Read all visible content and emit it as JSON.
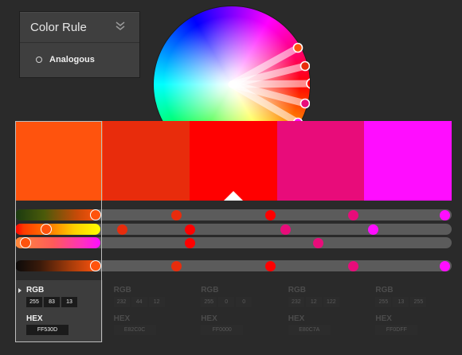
{
  "color_rule": {
    "title": "Color Rule",
    "selected_option": "Analogous",
    "collapse_icon": "double-chevron-down-icon"
  },
  "wheel": {
    "markers": [
      "#ff530d",
      "#e82c0c",
      "#ff0000",
      "#e80c7a",
      "#ff0dff"
    ],
    "selected_index": 2
  },
  "swatches": [
    {
      "hex": "#ff530d",
      "selected": true
    },
    {
      "hex": "#e82c0c",
      "selected": false
    },
    {
      "hex": "#ff0000",
      "selected": false
    },
    {
      "hex": "#e80c7a",
      "selected": false
    },
    {
      "hex": "#ff0dff",
      "selected": false
    }
  ],
  "slider_rows": [
    {
      "name": "brightness",
      "fill": "linear-gradient(90deg,#1a3a10 0%,#4a5a0a 35%,#c84a08 75%,#ff530d 100%)",
      "fill_fraction": 0.19,
      "handle_fraction": 0.185,
      "dot_fractions": [
        0.37,
        0.585,
        0.775,
        0.985
      ],
      "dot_colors": [
        "#e82c0c",
        "#ff0000",
        "#e80c7a",
        "#ff0dff"
      ]
    },
    {
      "name": "hue",
      "fill": "linear-gradient(90deg,#ff0000 0%,#ff3a00 10%,#ff7a00 40%,#ffd000 70%,#ffff00 100%)",
      "fill_fraction": 0.195,
      "handle_fraction": 0.072,
      "dot_fractions": [
        0.245,
        0.4,
        0.62,
        0.82
      ],
      "dot_colors": [
        "#e82c0c",
        "#ff0000",
        "#e80c7a",
        "#ff0dff"
      ]
    },
    {
      "name": "saturation",
      "fill": "linear-gradient(90deg,#ff8a3a 0%,#ff5a5a 45%,#ff30c0 80%,#ff0dff 100%)",
      "fill_fraction": 0.195,
      "handle_fraction": 0.024,
      "dot_fractions": [
        0.4,
        0.695
      ],
      "dot_colors": [
        "#ff0000",
        "#e80c7a"
      ]
    },
    {
      "name": "value",
      "fill": "linear-gradient(90deg,#0a0a0a 0%,#3a1a0a 30%,#a03a0a 65%,#ff530d 100%)",
      "fill_fraction": 0.19,
      "handle_fraction": 0.185,
      "dot_fractions": [
        0.37,
        0.585,
        0.775,
        0.985
      ],
      "dot_colors": [
        "#e82c0c",
        "#ff0000",
        "#e80c7a",
        "#ff0dff"
      ]
    }
  ],
  "value_panels": [
    {
      "rgb_label": "RGB",
      "hex_label": "HEX",
      "r": "255",
      "g": "83",
      "b": "13",
      "hex": "FF530D",
      "active": true
    },
    {
      "rgb_label": "RGB",
      "hex_label": "HEX",
      "r": "232",
      "g": "44",
      "b": "12",
      "hex": "E82C0C",
      "active": false
    },
    {
      "rgb_label": "RGB",
      "hex_label": "HEX",
      "r": "255",
      "g": "0",
      "b": "0",
      "hex": "FF0000",
      "active": false
    },
    {
      "rgb_label": "RGB",
      "hex_label": "HEX",
      "r": "232",
      "g": "12",
      "b": "122",
      "hex": "E80C7A",
      "active": false
    },
    {
      "rgb_label": "RGB",
      "hex_label": "HEX",
      "r": "255",
      "g": "13",
      "b": "255",
      "hex": "FF0DFF",
      "active": false
    }
  ]
}
